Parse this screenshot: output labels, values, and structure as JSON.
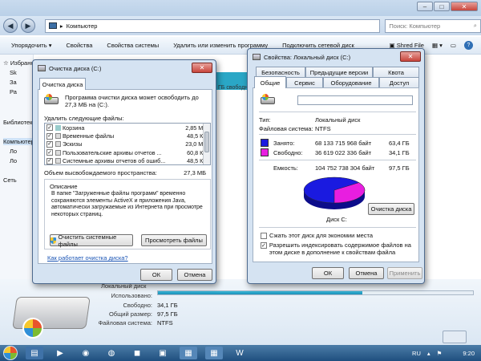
{
  "explorer": {
    "address": "Компьютер",
    "search_placeholder": "Поиск: Компьютер",
    "commands": [
      "Упорядочить ▾",
      "Свойства",
      "Свойства системы",
      "Удалить или изменить программу",
      "Подключить сетевой диск"
    ],
    "shred_label": "Shred File",
    "sidebar_items": [
      "Избранное",
      "Sk",
      "За",
      "Ра",
      "Библиотеки",
      "Компьютер",
      "Ло",
      "Ло",
      "Сеть"
    ],
    "bg_text": "ГБ свободно",
    "details": {
      "title_partial": "Локальный диск",
      "used_label": "Использовано:",
      "free_label": "Свободно:",
      "free_value": "34,1 ГБ",
      "total_label": "Общий размер:",
      "total_value": "97,5 ГБ",
      "fs_label": "Файловая система:",
      "fs_value": "NTFS",
      "used_fraction": 0.65
    }
  },
  "cleanup": {
    "title": "Очистка диска  (C:)",
    "tab": "Очистка диска",
    "intro": "Программа очистки диска может освободить до 27,3 МБ на  (C:).",
    "list_label": "Удалить следующие файлы:",
    "files": [
      {
        "name": "Корзина",
        "size": "2,85 МБ",
        "checked": "✓"
      },
      {
        "name": "Временные файлы",
        "size": "48,5 КБ",
        "checked": "✓"
      },
      {
        "name": "Эскизы",
        "size": "23,0 МБ",
        "checked": "✓"
      },
      {
        "name": "Пользовательские архивы отчетов ...",
        "size": "60,8 КБ",
        "checked": "✓"
      },
      {
        "name": "Системные архивы отчетов об ошиб...",
        "size": "48,5 КБ",
        "checked": "✓"
      }
    ],
    "space_label": "Объем высвобождаемого пространства:",
    "space_value": "27,3 МБ",
    "desc_title": "Описание",
    "desc_text": "В папке \"Загруженные файлы программ\" временно сохраняются элементы ActiveX и приложения Java, автоматически загружаемые из Интернета при просмотре некоторых страниц.",
    "clean_system_btn": "Очистить системные файлы",
    "view_files_btn": "Просмотреть файлы",
    "how_link": "Как работает очистка диска?",
    "ok": "ОК",
    "cancel": "Отмена"
  },
  "props": {
    "title": "Свойства: Локальный диск (C:)",
    "tabs_top": [
      "Безопасность",
      "Предыдущие версии",
      "Квота"
    ],
    "tabs_bottom": [
      "Общие",
      "Сервис",
      "Оборудование",
      "Доступ"
    ],
    "type_label": "Тип:",
    "type_value": "Локальный диск",
    "fs_label": "Файловая система:",
    "fs_value": "NTFS",
    "used_label": "Занято:",
    "used_bytes": "68 133 715 968 байт",
    "used_gb": "63,4 ГБ",
    "free_label": "Свободно:",
    "free_bytes": "36 619 022 336 байт",
    "free_gb": "34,1 ГБ",
    "cap_label": "Емкость:",
    "cap_bytes": "104 752 738 304 байт",
    "cap_gb": "97,5 ГБ",
    "disk_label": "Диск C:",
    "cleanup_btn": "Очистка диска",
    "compress_label": "Сжать этот диск для экономии места",
    "index_label": "Разрешить индексировать содержимое файлов на этом диске в дополнение к свойствам файла",
    "compress_checked": "",
    "index_checked": "✓",
    "ok": "ОК",
    "cancel": "Отмена",
    "apply": "Применить",
    "used_color": "#1a1ae0",
    "free_color": "#e81ee0",
    "pie_used_fraction": 0.65
  },
  "taskbar": {
    "lang": "RU",
    "time": "9:20"
  }
}
